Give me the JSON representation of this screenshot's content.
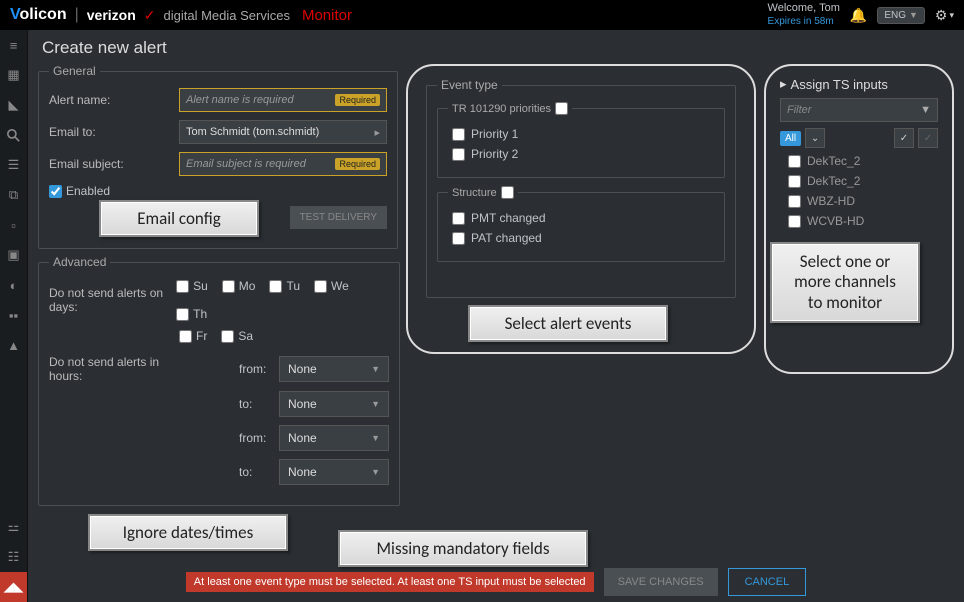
{
  "header": {
    "logo_volicon": "Volicon",
    "logo_verizon": "verizon",
    "dms": "digital Media Services",
    "monitor": "Monitor",
    "welcome": "Welcome, Tom",
    "expires": "Expires in 58m",
    "lang": "ENG"
  },
  "page_title": "Create new alert",
  "general": {
    "legend": "General",
    "alert_name_label": "Alert name:",
    "alert_name_placeholder": "Alert name is required",
    "required_badge": "Required",
    "email_to_label": "Email to:",
    "email_to_value": "Tom Schmidt (tom.schmidt)",
    "email_subject_label": "Email subject:",
    "email_subject_placeholder": "Email subject is required",
    "enabled_label": "Enabled",
    "test_delivery": "TEST DELIVERY"
  },
  "advanced": {
    "legend": "Advanced",
    "no_send_days_label": "Do not send alerts on days:",
    "days": {
      "su": "Su",
      "mo": "Mo",
      "tu": "Tu",
      "we": "We",
      "th": "Th",
      "fr": "Fr",
      "sa": "Sa"
    },
    "no_send_hours_label": "Do not send alerts in hours:",
    "from": "from:",
    "to": "to:",
    "none": "None"
  },
  "event": {
    "legend": "Event type",
    "tr_legend": "TR 101290 priorities",
    "p1": "Priority 1",
    "p2": "Priority 2",
    "struct_legend": "Structure",
    "pmt": "PMT changed",
    "pat": "PAT changed"
  },
  "assign": {
    "title": "Assign TS inputs",
    "filter_placeholder": "Filter",
    "all": "All",
    "channels": [
      "DekTec_2",
      "DekTec_2",
      "WBZ-HD",
      "WCVB-HD"
    ]
  },
  "callouts": {
    "email": "Email config",
    "events": "Select alert events",
    "channels1": "Select one or",
    "channels2": "more channels",
    "channels3": "to monitor",
    "ignore": "Ignore dates/times",
    "missing": "Missing mandatory fields"
  },
  "footer": {
    "error": "At least one event type must be selected. At least one TS input must be selected",
    "save": "SAVE CHANGES",
    "cancel": "CANCEL"
  }
}
